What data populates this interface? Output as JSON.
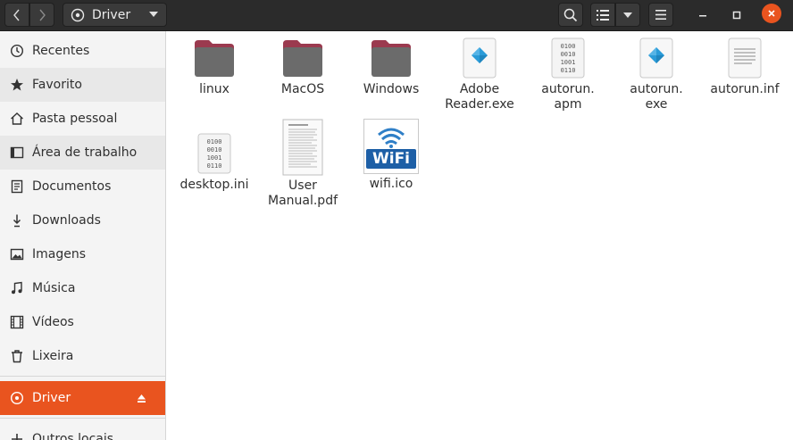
{
  "header": {
    "path_label": "Driver",
    "icons": {
      "back": "chevron-left-icon",
      "forward": "chevron-right-icon",
      "search": "search-icon",
      "view": "list-view-icon",
      "menu": "hamburger-menu-icon",
      "minimize": "minimize-icon",
      "maximize": "maximize-icon",
      "close": "close-icon"
    }
  },
  "sidebar": {
    "items": [
      {
        "label": "Recentes",
        "icon": "clock-icon"
      },
      {
        "label": "Favorito",
        "icon": "star-icon"
      },
      {
        "label": "Pasta pessoal",
        "icon": "home-icon"
      },
      {
        "label": "Área de trabalho",
        "icon": "desktop-icon"
      },
      {
        "label": "Documentos",
        "icon": "document-icon"
      },
      {
        "label": "Downloads",
        "icon": "download-icon"
      },
      {
        "label": "Imagens",
        "icon": "image-icon"
      },
      {
        "label": "Música",
        "icon": "music-icon"
      },
      {
        "label": "Vídeos",
        "icon": "video-icon"
      },
      {
        "label": "Lixeira",
        "icon": "trash-icon"
      },
      {
        "label": "Driver",
        "icon": "disc-icon"
      },
      {
        "label": "Outros locais",
        "icon": "plus-icon"
      }
    ]
  },
  "files": [
    {
      "label": "linux",
      "type": "folder"
    },
    {
      "label": "MacOS",
      "type": "folder"
    },
    {
      "label": "Windows",
      "type": "folder"
    },
    {
      "label": "Adobe\nReader.exe",
      "type": "executable"
    },
    {
      "label": "autorun.\napm",
      "type": "binary"
    },
    {
      "label": "autorun.\nexe",
      "type": "executable"
    },
    {
      "label": "autorun.inf",
      "type": "text"
    },
    {
      "label": "desktop.ini",
      "type": "binary"
    },
    {
      "label": "User\nManual.pdf",
      "type": "pdf"
    },
    {
      "label": "wifi.ico",
      "type": "image",
      "image_text": "WiFi"
    }
  ],
  "colors": {
    "accent": "#e9541f",
    "headerbar": "#2b2b2b",
    "folder_tab": "#9b3a4f",
    "folder_body": "#6b6b6b",
    "exe_diamond": "#2a9bd8"
  }
}
